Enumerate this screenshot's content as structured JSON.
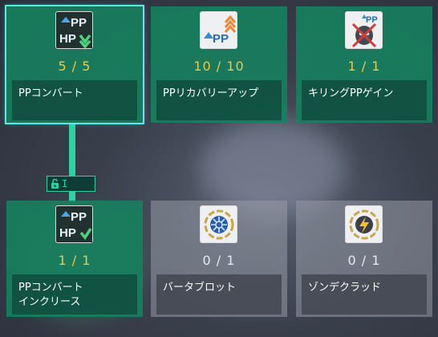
{
  "colors": {
    "learned_bg": "#16825f",
    "locked_bg": "#969ba5",
    "selected_border": "#5fe6ea",
    "level_gold": "#ecc84a",
    "connector": "#2fd1a3"
  },
  "connector_badge": {
    "icon": "unlock-icon",
    "text": "I"
  },
  "skills": [
    {
      "icon": "pp-convert-icon",
      "level": "5 / 5",
      "name": "PPコンバート",
      "state": "learned",
      "selected": true
    },
    {
      "icon": "pp-recovery-up-icon",
      "level": "10 / 10",
      "name": "PPリカバリーアップ",
      "state": "learned",
      "selected": false
    },
    {
      "icon": "killing-pp-gain-icon",
      "level": "1 / 1",
      "name": "キリングPPゲイン",
      "state": "learned",
      "selected": false
    },
    {
      "icon": "pp-convert-increase-icon",
      "level": "1 / 1",
      "name_line1": "PPコンバート",
      "name_line2": "インクリース",
      "state": "learned",
      "selected": false
    },
    {
      "icon": "barta-blot-icon",
      "level": "0 / 1",
      "name": "バータブロット",
      "state": "locked",
      "selected": false
    },
    {
      "icon": "zonde-clad-icon",
      "level": "0 / 1",
      "name": "ゾンデクラッド",
      "state": "locked",
      "selected": false
    }
  ]
}
